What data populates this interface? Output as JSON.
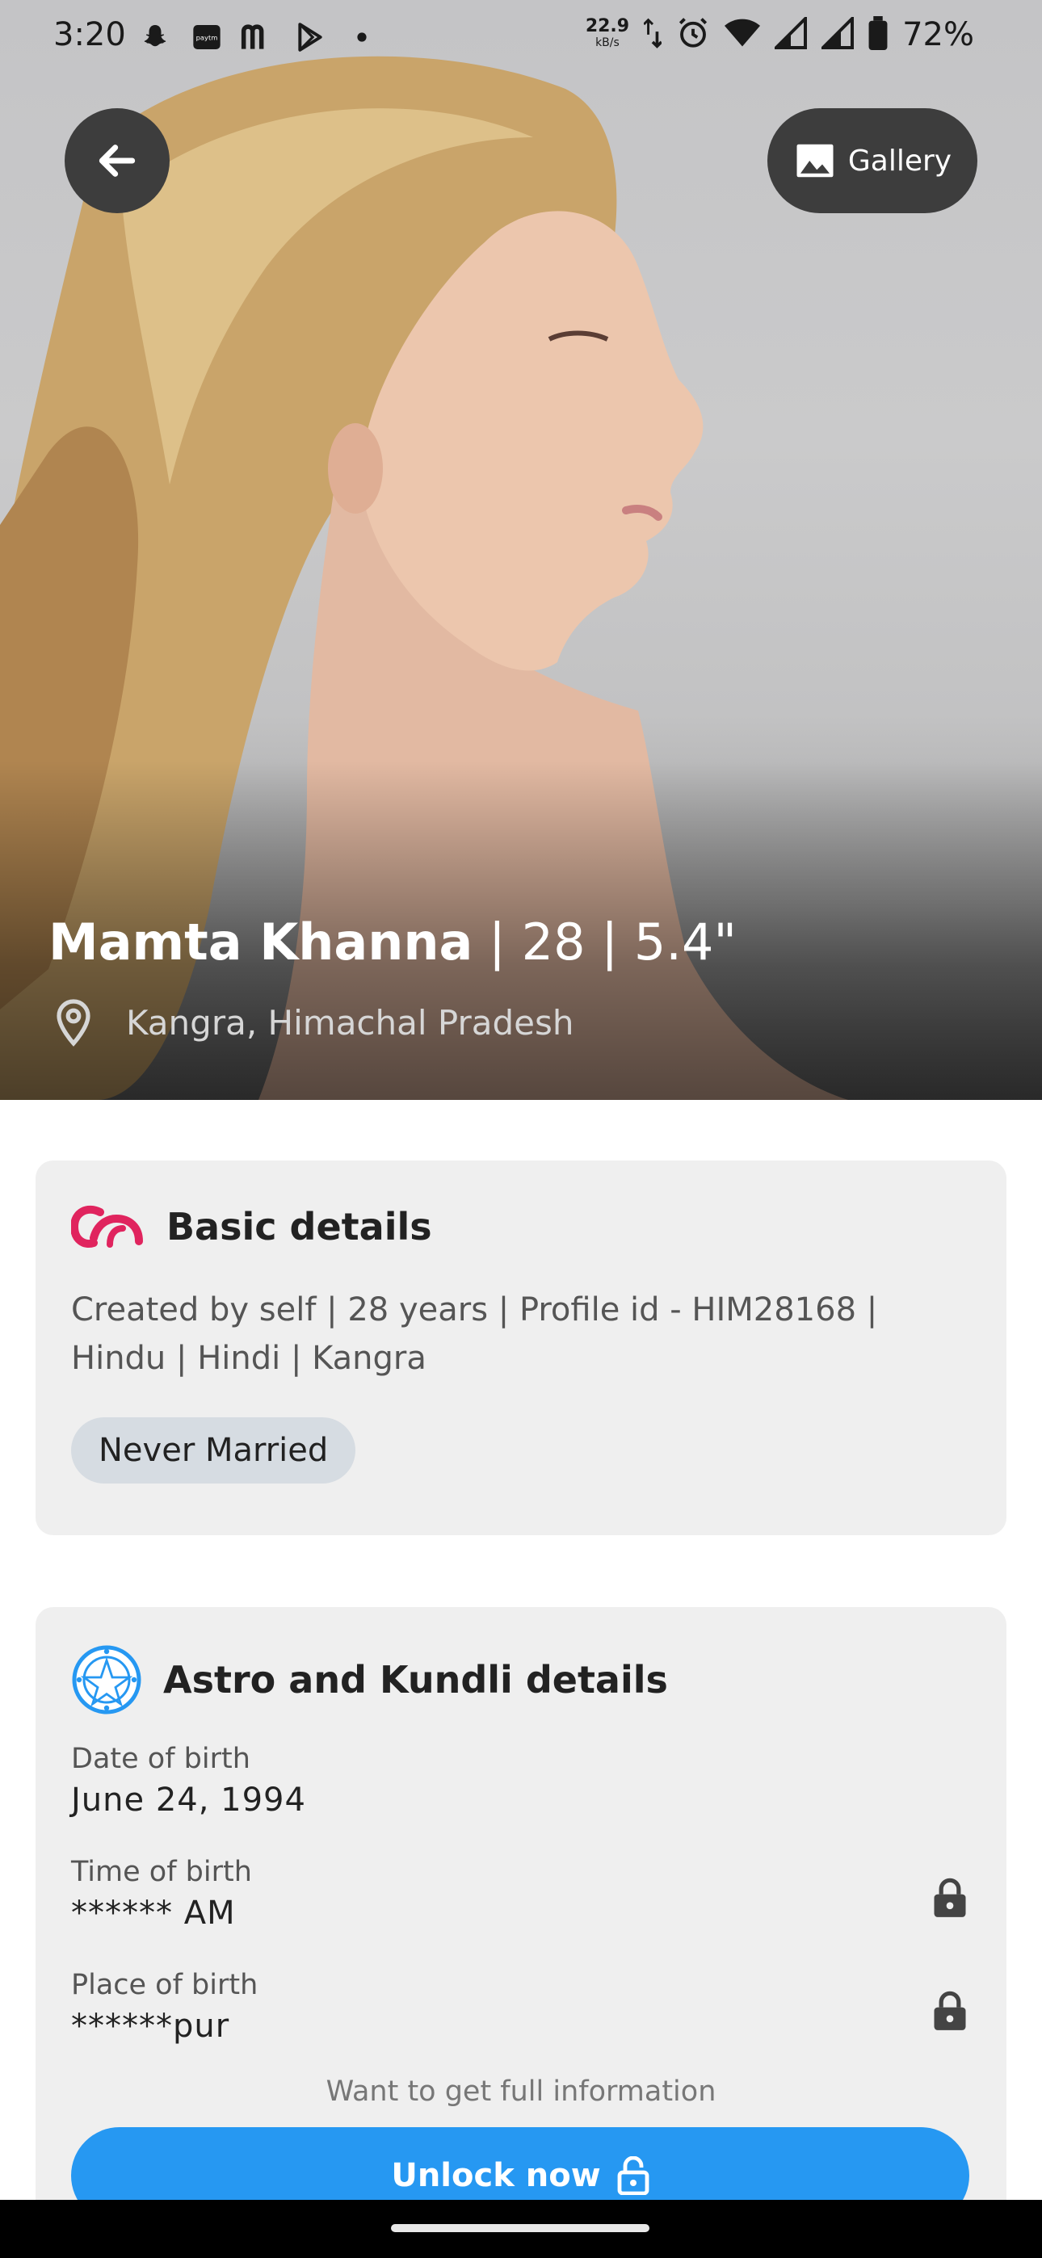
{
  "status_bar": {
    "time": "3:20",
    "net_speed": "22.9",
    "net_unit": "kB/s",
    "battery": "72%",
    "left_icons": [
      "snapchat-icon",
      "paytm-icon",
      "m-app-icon",
      "play-store-icon",
      "dot-icon"
    ],
    "right_icons": [
      "data-arrows-icon",
      "alarm-icon",
      "wifi-icon",
      "signal-icon",
      "signal-icon",
      "battery-icon"
    ]
  },
  "hero": {
    "gallery_label": "Gallery",
    "name": "Mamta Khanna",
    "meta": " | 28 | 5.4\"",
    "location": "Kangra, Himachal Pradesh"
  },
  "basic": {
    "title": "Basic details",
    "description": "Created by self | 28 years | Profile id - HIM28168 | Hindu | Hindi | Kangra",
    "chip": "Never Married"
  },
  "astro": {
    "title": "Astro and Kundli details",
    "fields": [
      {
        "label": "Date of birth",
        "value": "June 24, 1994",
        "locked": false
      },
      {
        "label": "Time of birth",
        "value": "****** AM",
        "locked": true
      },
      {
        "label": "Place of birth",
        "value": "******pur",
        "locked": true
      }
    ],
    "prompt": "Want to get full information",
    "unlock_label": "Unlock now"
  },
  "colors": {
    "accent": "#2698f2",
    "brand": "#e0245e",
    "card_bg": "#efefef"
  }
}
